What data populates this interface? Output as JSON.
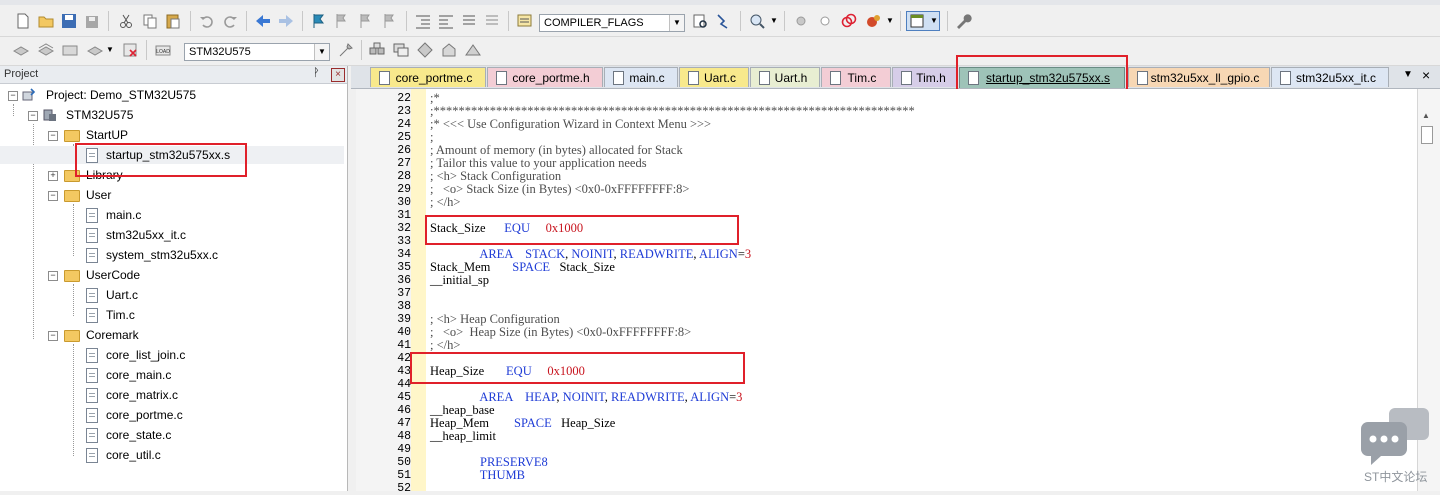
{
  "toolbar1": {
    "compiler_combo": "COMPILER_FLAGS"
  },
  "toolbar2": {
    "target_combo": "STM32U575"
  },
  "project": {
    "panel_title": "Project",
    "root": "Project: Demo_STM32U575",
    "target": "STM32U575",
    "groups": [
      {
        "name": "StartUP",
        "files": [
          "startup_stm32u575xx.s"
        ]
      },
      {
        "name": "Library",
        "files": []
      },
      {
        "name": "User",
        "files": [
          "main.c",
          "stm32u5xx_it.c",
          "system_stm32u5xx.c"
        ]
      },
      {
        "name": "UserCode",
        "files": [
          "Uart.c",
          "Tim.c"
        ]
      },
      {
        "name": "Coremark",
        "files": [
          "core_list_join.c",
          "core_main.c",
          "core_matrix.c",
          "core_portme.c",
          "core_state.c",
          "core_util.c"
        ]
      }
    ]
  },
  "tabs": [
    {
      "label": "core_portme.c",
      "color": "#f8e98c"
    },
    {
      "label": "core_portme.h",
      "color": "#f3cdd5"
    },
    {
      "label": "main.c",
      "color": "#dde6f3"
    },
    {
      "label": "Uart.c",
      "color": "#f8e98c"
    },
    {
      "label": "Uart.h",
      "color": "#e8eed2"
    },
    {
      "label": "Tim.c",
      "color": "#f3cdd5"
    },
    {
      "label": "Tim.h",
      "color": "#d6cde8"
    },
    {
      "label": "startup_stm32u575xx.s",
      "color": "#9ec3b8"
    },
    {
      "label": "stm32u5xx_ll_gpio.c",
      "color": "#f7d7b4"
    },
    {
      "label": "stm32u5xx_it.c",
      "color": "#dde6f3"
    }
  ],
  "editor": {
    "lines": [
      {
        "n": "22",
        "text": ";*"
      },
      {
        "n": "23",
        "text": ";*****************************************************************************"
      },
      {
        "n": "24",
        "text": ";* <<< Use Configuration Wizard in Context Menu >>>"
      },
      {
        "n": "25",
        "text": ";"
      },
      {
        "n": "26",
        "text": "; Amount of memory (in bytes) allocated for Stack"
      },
      {
        "n": "27",
        "text": "; Tailor this value to your application needs"
      },
      {
        "n": "28",
        "text": "; <h> Stack Configuration"
      },
      {
        "n": "29",
        "text": ";   <o> Stack Size (in Bytes) <0x0-0xFFFFFFFF:8>"
      },
      {
        "n": "30",
        "text": "; </h>"
      },
      {
        "n": "31",
        "text": ""
      },
      {
        "n": "32",
        "text": "Stack_Size      EQU     0x1000"
      },
      {
        "n": "33",
        "text": ""
      },
      {
        "n": "34",
        "text": "                AREA    STACK, NOINIT, READWRITE, ALIGN=3"
      },
      {
        "n": "35",
        "text": "Stack_Mem       SPACE   Stack_Size"
      },
      {
        "n": "36",
        "text": "__initial_sp"
      },
      {
        "n": "37",
        "text": ""
      },
      {
        "n": "38",
        "text": ""
      },
      {
        "n": "39",
        "text": "; <h> Heap Configuration"
      },
      {
        "n": "40",
        "text": ";   <o>  Heap Size (in Bytes) <0x0-0xFFFFFFFF:8>"
      },
      {
        "n": "41",
        "text": "; </h>"
      },
      {
        "n": "42",
        "text": ""
      },
      {
        "n": "43",
        "text": "Heap_Size       EQU     0x1000"
      },
      {
        "n": "44",
        "text": ""
      },
      {
        "n": "45",
        "text": "                AREA    HEAP, NOINIT, READWRITE, ALIGN=3"
      },
      {
        "n": "46",
        "text": "__heap_base"
      },
      {
        "n": "47",
        "text": "Heap_Mem        SPACE   Heap_Size"
      },
      {
        "n": "48",
        "text": "__heap_limit"
      },
      {
        "n": "49",
        "text": ""
      },
      {
        "n": "50",
        "text": "                PRESERVE8"
      },
      {
        "n": "51",
        "text": "                THUMB"
      },
      {
        "n": "52",
        "text": ""
      }
    ]
  },
  "watermark": {
    "text": "ST中文论坛"
  },
  "colors": {
    "highlight_red": "#e0202a",
    "keyword_blue": "#1f3cd6",
    "number_red": "#c8141e"
  }
}
